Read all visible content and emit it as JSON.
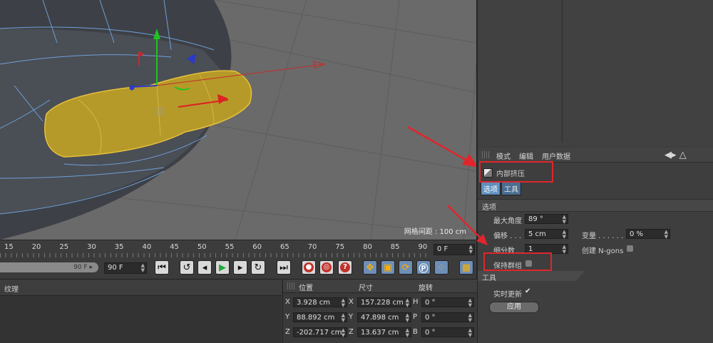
{
  "viewport": {
    "grid_spacing": "网格间距 : 100 cm"
  },
  "attribute_manager": {
    "menu": [
      "模式",
      "编辑",
      "用户数据"
    ],
    "object_title": "内部挤压",
    "tabs": [
      "选项",
      "工具"
    ],
    "options_section": "选项",
    "max_angle": {
      "label": "最大角度",
      "value": "89 °"
    },
    "offset": {
      "label": "偏移 . . .",
      "value": "5 cm"
    },
    "subdivisions": {
      "label": "细分数 . .",
      "value": "1"
    },
    "variance": {
      "label": "变量 . . . . . . .",
      "value": "0 %"
    },
    "create_ngons": {
      "label": "创建 N-gons"
    },
    "preserve_groups": {
      "label": "保持群组"
    },
    "tool_section": "工具",
    "realtime_update": {
      "label": "实时更新",
      "checked": true,
      "check_glyph": "✔"
    },
    "apply_label": "应用"
  },
  "timeline": {
    "ticks": [
      "15",
      "20",
      "25",
      "30",
      "35",
      "40",
      "45",
      "50",
      "55",
      "60",
      "65",
      "70",
      "75",
      "80",
      "85",
      "90"
    ],
    "current_frame": "0 F"
  },
  "transport": {
    "slider_value": "90 F",
    "end_frame": "90 F"
  },
  "material_panel": {
    "title": "纹理"
  },
  "coordinates": {
    "headers": {
      "position": "位置",
      "size": "尺寸",
      "rotation": "旋转"
    },
    "rows": [
      {
        "pos_axis": "X",
        "pos": "3.928 cm",
        "size_axis": "X",
        "size": "157.228 cm",
        "rot_axis": "H",
        "rot": "0 °"
      },
      {
        "pos_axis": "Y",
        "pos": "88.892 cm",
        "size_axis": "Y",
        "size": "47.898 cm",
        "rot_axis": "P",
        "rot": "0 °"
      },
      {
        "pos_axis": "Z",
        "pos": "-202.717 cm",
        "size_axis": "Z",
        "size": "13.637 cm",
        "rot_axis": "B",
        "rot": "0 °"
      }
    ]
  },
  "colors": {
    "annotation_red": "#e0262b",
    "selection_yellow": "#b59a2a",
    "active_tab_blue": "#5f8fbf"
  }
}
